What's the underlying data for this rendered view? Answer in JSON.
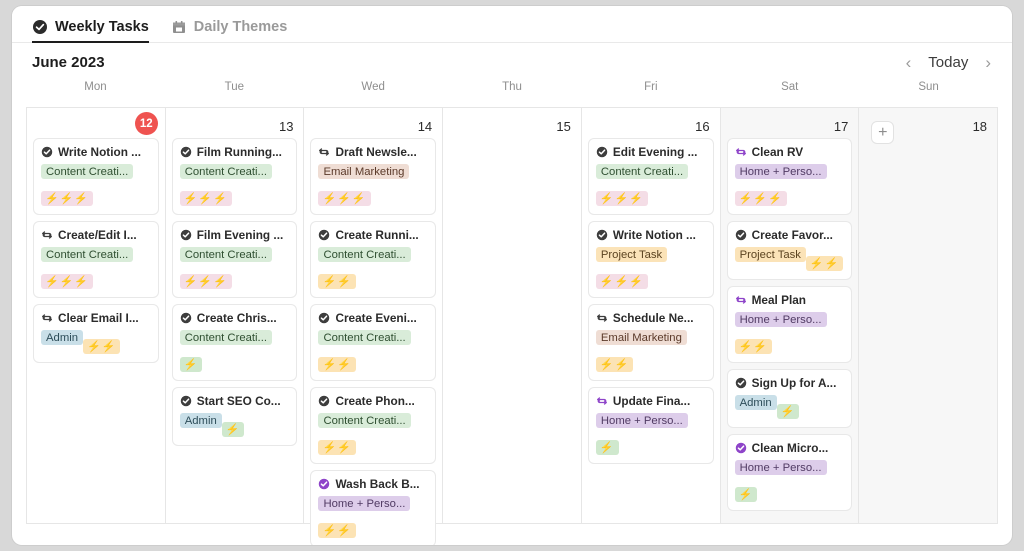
{
  "tabs": [
    {
      "label": "Weekly Tasks",
      "icon": "check-circle-icon",
      "active": true
    },
    {
      "label": "Daily Themes",
      "icon": "calendar-icon",
      "active": false
    }
  ],
  "header": {
    "month_title": "June 2023",
    "today_label": "Today",
    "prev_icon": "chevron-left-icon",
    "next_icon": "chevron-right-icon"
  },
  "weekdays": [
    "Mon",
    "Tue",
    "Wed",
    "Thu",
    "Fri",
    "Sat",
    "Sun"
  ],
  "add_button": {
    "icon": "plus-icon",
    "label": "+"
  },
  "tag_colors": {
    "Content Creation": {
      "bg": "#d9ecd9",
      "fg": "#2f4f31"
    },
    "Email Marketing": {
      "bg": "#efddd4",
      "fg": "#5b3a2a"
    },
    "Project Task": {
      "bg": "#fbe3b8",
      "fg": "#5b4320"
    },
    "Admin": {
      "bg": "#c9dfe8",
      "fg": "#2d4d59"
    },
    "Home + Personal": {
      "bg": "#ddcdea",
      "fg": "#503a63"
    }
  },
  "priority_colors": {
    "3": {
      "bg": "#f4dde6"
    },
    "2": {
      "bg": "#fce3b4"
    },
    "1": {
      "bg": "#cfe8cd"
    }
  },
  "badge": {
    "value": "12",
    "color": "#ef5350"
  },
  "days": [
    {
      "weekday": "Mon",
      "daynum": "12",
      "weekend": false,
      "has_badge": true,
      "has_add": false,
      "tasks": [
        {
          "title": "Write Notion ...",
          "icon": "check-circle-icon",
          "icon_color": "#3d3d3d",
          "tag": "Content Creati...",
          "tag_key": "Content Creation",
          "priority": 3
        },
        {
          "title": "Create/Edit I...",
          "icon": "recurring-icon",
          "icon_color": "#3d3d3d",
          "tag": "Content Creati...",
          "tag_key": "Content Creation",
          "priority": 3
        },
        {
          "title": "Clear Email I...",
          "icon": "recurring-icon",
          "icon_color": "#3d3d3d",
          "tag": "Admin",
          "tag_key": "Admin",
          "priority": 2
        }
      ]
    },
    {
      "weekday": "Tue",
      "daynum": "13",
      "weekend": false,
      "has_badge": false,
      "has_add": false,
      "tasks": [
        {
          "title": "Film Running...",
          "icon": "check-circle-icon",
          "icon_color": "#3d3d3d",
          "tag": "Content Creati...",
          "tag_key": "Content Creation",
          "priority": 3
        },
        {
          "title": "Film Evening ...",
          "icon": "check-circle-icon",
          "icon_color": "#3d3d3d",
          "tag": "Content Creati...",
          "tag_key": "Content Creation",
          "priority": 3
        },
        {
          "title": "Create Chris...",
          "icon": "check-circle-icon",
          "icon_color": "#3d3d3d",
          "tag": "Content Creati...",
          "tag_key": "Content Creation",
          "priority": 1
        },
        {
          "title": "Start SEO Co...",
          "icon": "check-circle-icon",
          "icon_color": "#3d3d3d",
          "tag": "Admin",
          "tag_key": "Admin",
          "priority": 1
        }
      ]
    },
    {
      "weekday": "Wed",
      "daynum": "14",
      "weekend": false,
      "has_badge": false,
      "has_add": false,
      "tasks": [
        {
          "title": "Draft Newsle...",
          "icon": "recurring-icon",
          "icon_color": "#3d3d3d",
          "tag": "Email Marketing",
          "tag_key": "Email Marketing",
          "priority": 3
        },
        {
          "title": "Create Runni...",
          "icon": "check-circle-icon",
          "icon_color": "#3d3d3d",
          "tag": "Content Creati...",
          "tag_key": "Content Creation",
          "priority": 2
        },
        {
          "title": "Create Eveni...",
          "icon": "check-circle-icon",
          "icon_color": "#3d3d3d",
          "tag": "Content Creati...",
          "tag_key": "Content Creation",
          "priority": 2
        },
        {
          "title": "Create Phon...",
          "icon": "check-circle-icon",
          "icon_color": "#3d3d3d",
          "tag": "Content Creati...",
          "tag_key": "Content Creation",
          "priority": 2
        },
        {
          "title": "Wash Back B...",
          "icon": "check-circle-icon",
          "icon_color": "#8e44c9",
          "tag": "Home + Perso...",
          "tag_key": "Home + Personal",
          "priority": 2
        }
      ]
    },
    {
      "weekday": "Thu",
      "daynum": "15",
      "weekend": false,
      "has_badge": false,
      "has_add": false,
      "tasks": []
    },
    {
      "weekday": "Fri",
      "daynum": "16",
      "weekend": false,
      "has_badge": false,
      "has_add": false,
      "tasks": [
        {
          "title": "Edit Evening ...",
          "icon": "check-circle-icon",
          "icon_color": "#3d3d3d",
          "tag": "Content Creati...",
          "tag_key": "Content Creation",
          "priority": 3
        },
        {
          "title": "Write Notion ...",
          "icon": "check-circle-icon",
          "icon_color": "#3d3d3d",
          "tag": "Project Task",
          "tag_key": "Project Task",
          "priority": 3
        },
        {
          "title": "Schedule Ne...",
          "icon": "recurring-icon",
          "icon_color": "#3d3d3d",
          "tag": "Email Marketing",
          "tag_key": "Email Marketing",
          "priority": 2
        },
        {
          "title": "Update Fina...",
          "icon": "recurring-icon",
          "icon_color": "#8e44c9",
          "tag": "Home + Perso...",
          "tag_key": "Home + Personal",
          "priority": 1
        }
      ]
    },
    {
      "weekday": "Sat",
      "daynum": "17",
      "weekend": true,
      "has_badge": false,
      "has_add": false,
      "tasks": [
        {
          "title": "Clean RV",
          "icon": "recurring-icon",
          "icon_color": "#8e44c9",
          "tag": "Home + Perso...",
          "tag_key": "Home + Personal",
          "priority": 3
        },
        {
          "title": "Create Favor...",
          "icon": "check-circle-icon",
          "icon_color": "#3d3d3d",
          "tag": "Project Task",
          "tag_key": "Project Task",
          "priority": 2
        },
        {
          "title": "Meal Plan",
          "icon": "recurring-icon",
          "icon_color": "#8e44c9",
          "tag": "Home + Perso...",
          "tag_key": "Home + Personal",
          "priority": 2
        },
        {
          "title": "Sign Up for A...",
          "icon": "check-circle-icon",
          "icon_color": "#3d3d3d",
          "tag": "Admin",
          "tag_key": "Admin",
          "priority": 1
        },
        {
          "title": "Clean Micro...",
          "icon": "check-circle-icon",
          "icon_color": "#8e44c9",
          "tag": "Home + Perso...",
          "tag_key": "Home + Personal",
          "priority": 1
        }
      ]
    },
    {
      "weekday": "Sun",
      "daynum": "18",
      "weekend": true,
      "has_badge": false,
      "has_add": true,
      "tasks": []
    }
  ]
}
